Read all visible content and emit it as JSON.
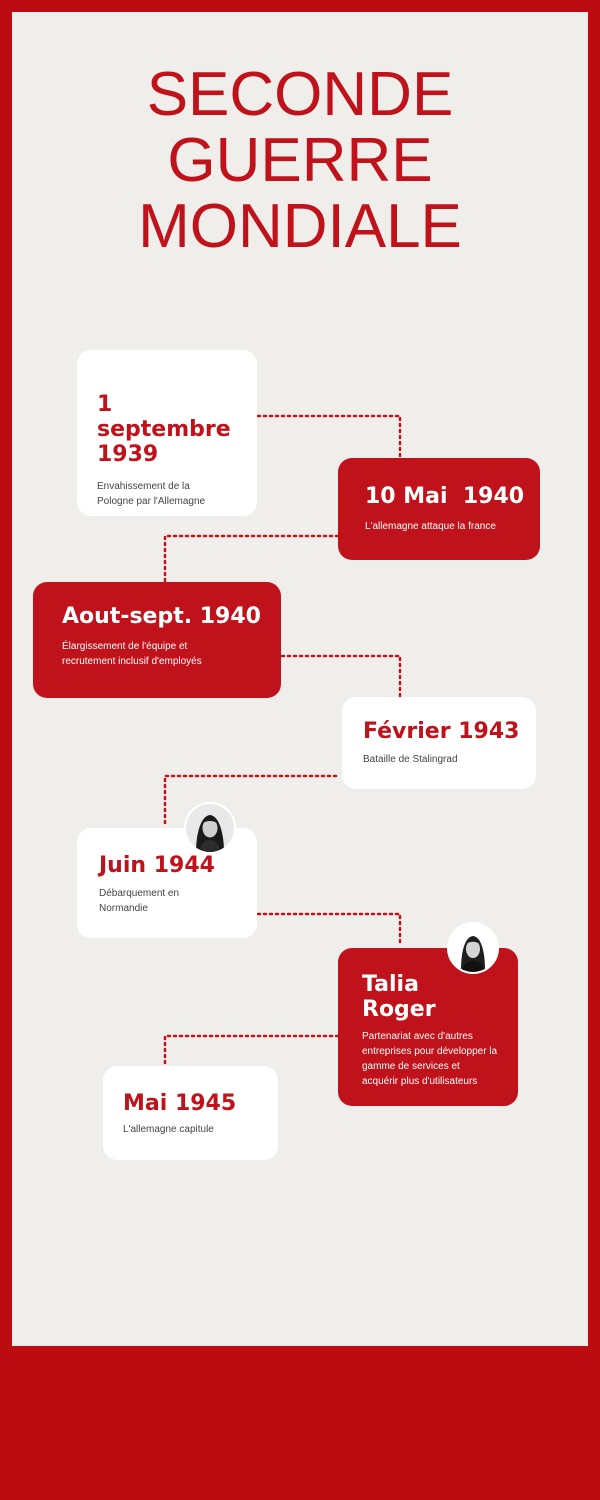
{
  "title": {
    "line1": "SECONDE",
    "line2": "GUERRE",
    "line3": "MONDIALE"
  },
  "events": [
    {
      "date": "1 septembre 1939",
      "text": "Envahissement de la Pologne par l'Allemagne"
    },
    {
      "date": "10 Mai  1940",
      "text": "L'allemagne attaque la france"
    },
    {
      "date": "Aout-sept. 1940",
      "text": "Élargissement de l'équipe et recrutement inclusif d'employés"
    },
    {
      "date": "Février 1943",
      "text": "Bataille de Stalingrad"
    },
    {
      "date": "Juin 1944",
      "text": "Débarquement en Normandie"
    },
    {
      "date": "Talia Roger",
      "text": "Partenariat avec d'autres entreprises pour développer la gamme de services et acquérir plus d'utilisateurs"
    },
    {
      "date": "Mai 1945",
      "text": "L'allemagne capitule"
    }
  ],
  "colors": {
    "accent": "#c0121a",
    "border": "#bd0b12",
    "panel": "#f0eeeb",
    "card": "#ffffff"
  }
}
